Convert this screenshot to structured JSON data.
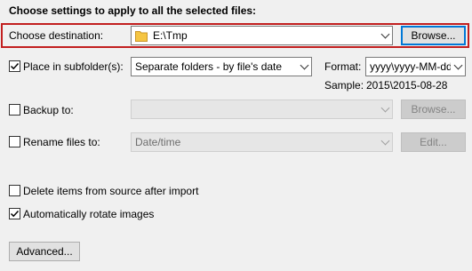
{
  "heading": "Choose settings to apply to all the selected files:",
  "destination": {
    "label": "Choose destination:",
    "value": "E:\\Tmp",
    "browse_label": "Browse..."
  },
  "subfolder": {
    "checked": true,
    "label": "Place in subfolder(s):",
    "mode": "Separate folders - by file's date",
    "format_label": "Format:",
    "format_value": "yyyy\\yyyy-MM-dd",
    "sample_label": "Sample:",
    "sample_value": "2015\\2015-08-28"
  },
  "backup": {
    "checked": false,
    "label": "Backup to:",
    "value": "",
    "browse_label": "Browse..."
  },
  "rename": {
    "checked": false,
    "label": "Rename files to:",
    "value": "Date/time",
    "edit_label": "Edit..."
  },
  "delete_items": {
    "checked": false,
    "label": "Delete items from source after import"
  },
  "auto_rotate": {
    "checked": true,
    "label": "Automatically rotate images"
  },
  "advanced_label": "Advanced...",
  "colors": {
    "highlight_border": "#c21f1f",
    "focus_border": "#0078d7",
    "folder_yellow": "#f5c542"
  }
}
